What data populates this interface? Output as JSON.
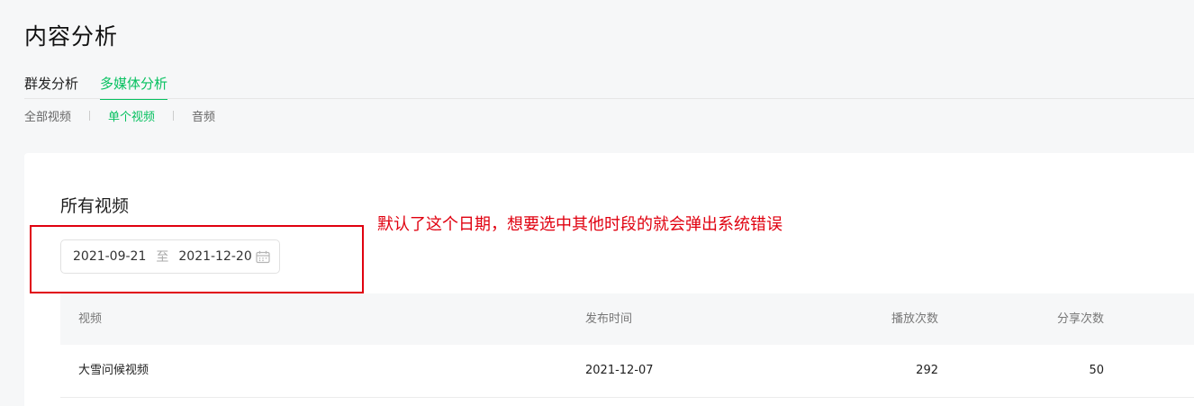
{
  "page": {
    "title": "内容分析"
  },
  "main_tabs": [
    {
      "label": "群发分析",
      "active": false
    },
    {
      "label": "多媒体分析",
      "active": true
    }
  ],
  "sub_tabs": [
    {
      "label": "全部视频",
      "active": false
    },
    {
      "label": "单个视频",
      "active": true
    },
    {
      "label": "音频",
      "active": false
    }
  ],
  "section": {
    "title": "所有视频",
    "date_range": {
      "start": "2021-09-21",
      "separator": "至",
      "end": "2021-12-20",
      "icon": "calendar-icon"
    }
  },
  "table": {
    "columns": [
      "视频",
      "发布时间",
      "播放次数",
      "分享次数"
    ],
    "rows": [
      [
        "大雪问候视频",
        "2021-12-07",
        "292",
        "50"
      ]
    ]
  },
  "annotation": {
    "text": "默认了这个日期，想要选中其他时段的就会弹出系统错误",
    "color": "#e0000f"
  },
  "colors": {
    "accent": "#07c160"
  }
}
